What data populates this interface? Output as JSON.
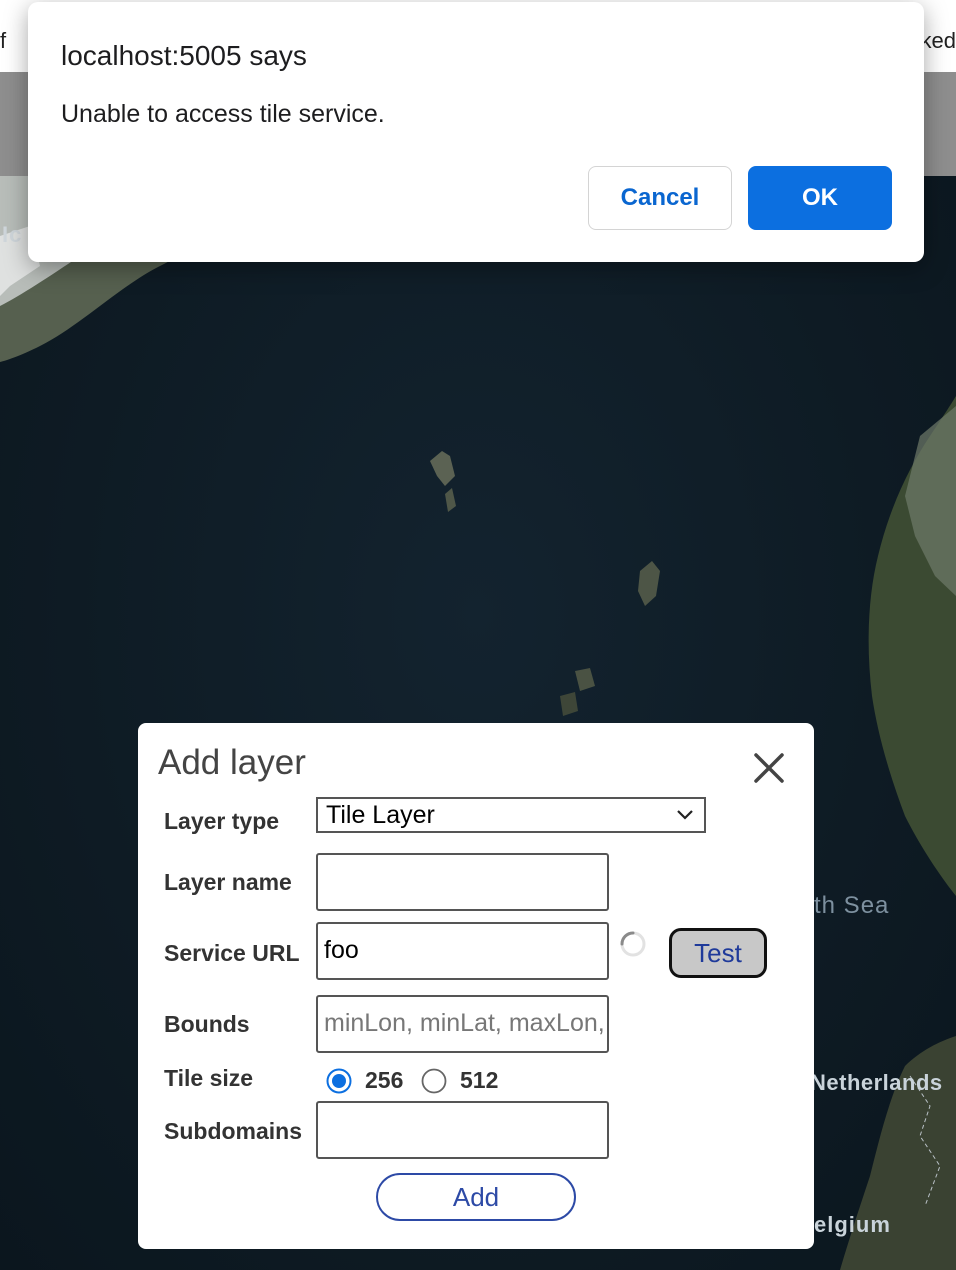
{
  "background": {
    "topbar_left_text": "f",
    "topbar_right_text": "ked",
    "map_labels": {
      "iceland": "Ic",
      "north_sea": "th Sea",
      "netherlands": "Netherlands",
      "belgium": "elgium"
    }
  },
  "alert": {
    "title": "localhost:5005 says",
    "message": "Unable to access tile service.",
    "cancel_label": "Cancel",
    "ok_label": "OK"
  },
  "add_layer": {
    "title": "Add layer",
    "close_icon": "close-icon",
    "layer_type": {
      "label": "Layer type",
      "value": "Tile Layer"
    },
    "layer_name": {
      "label": "Layer name",
      "value": ""
    },
    "service_url": {
      "label": "Service URL",
      "value": "foo",
      "test_label": "Test"
    },
    "bounds": {
      "label": "Bounds",
      "placeholder": "minLon, minLat, maxLon, maxLat"
    },
    "tile_size": {
      "label": "Tile size",
      "options": [
        "256",
        "512"
      ],
      "selected": "256"
    },
    "subdomains": {
      "label": "Subdomains",
      "value": ""
    },
    "add_label": "Add"
  },
  "colors": {
    "alert_ok": "#0c6fe0",
    "alert_cancel_text": "#0a66d0",
    "add_button": "#2d4aa6",
    "test_button_bg": "#c8c8c8"
  }
}
